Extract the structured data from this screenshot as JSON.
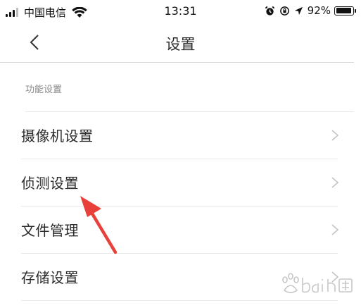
{
  "status_bar": {
    "carrier": "中国电信",
    "time": "13:31",
    "battery_percent": "92%",
    "battery_level": 0.92,
    "icons": [
      "signal-icon",
      "wifi-icon",
      "alarm-icon",
      "orientation-lock-icon",
      "location-icon",
      "battery-icon"
    ]
  },
  "nav": {
    "title": "设置",
    "back_icon": "chevron-left-icon"
  },
  "section": {
    "header": "功能设置",
    "items": [
      {
        "label": "摄像机设置",
        "icon": "chevron-right-icon"
      },
      {
        "label": "侦测设置",
        "icon": "chevron-right-icon"
      },
      {
        "label": "文件管理",
        "icon": "chevron-right-icon"
      },
      {
        "label": "存储设置",
        "icon": "chevron-right-icon"
      }
    ]
  },
  "annotation": {
    "arrow_color": "#e8403a",
    "points_to": "侦测设置"
  },
  "watermark": {
    "logo": "baidu-jingyan-watermark"
  },
  "colors": {
    "text_primary": "#2b2b2b",
    "text_secondary": "#8a8a8a",
    "divider": "#e8e8e8",
    "chevron": "#c4c4c4",
    "annotation": "#e8403a"
  }
}
